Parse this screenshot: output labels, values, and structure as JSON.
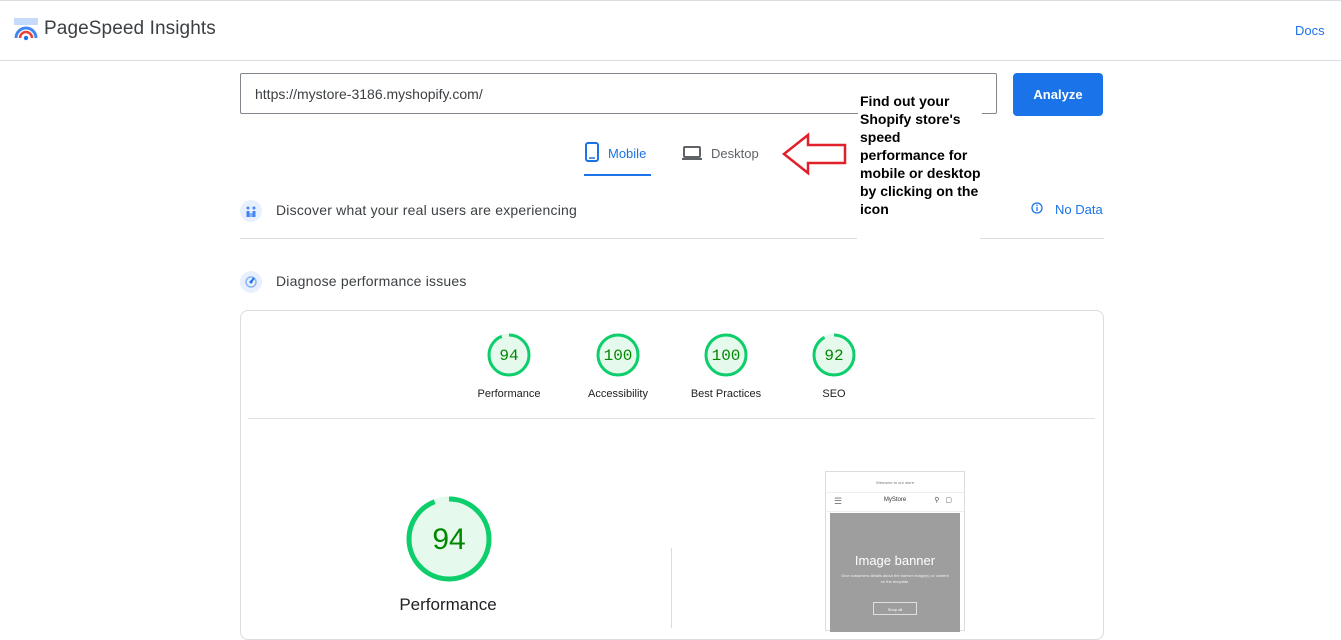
{
  "header": {
    "title": "PageSpeed Insights",
    "docs_label": "Docs"
  },
  "search": {
    "url_value": "https://mystore-3186.myshopify.com/",
    "analyze_label": "Analyze"
  },
  "tabs": [
    {
      "label": "Mobile",
      "icon": "phone-icon",
      "active": true
    },
    {
      "label": "Desktop",
      "icon": "laptop-icon",
      "active": false
    }
  ],
  "annotation": {
    "text": "Find out your Shopify store's speed performance for mobile or desktop by clicking on the icon",
    "arrow_color": "#e0202a"
  },
  "field_data": {
    "title": "Discover what your real users are experiencing",
    "no_data_label": "No Data"
  },
  "lab_data": {
    "title": "Diagnose performance issues"
  },
  "scores": [
    {
      "label": "Performance",
      "value": 94
    },
    {
      "label": "Accessibility",
      "value": 100
    },
    {
      "label": "Best Practices",
      "value": 100
    },
    {
      "label": "SEO",
      "value": 92
    }
  ],
  "main_score": {
    "label": "Performance",
    "value": 94
  },
  "preview": {
    "top_text": "Welcome to our store",
    "store_name": "MyStore",
    "banner_title": "Image banner",
    "banner_subtitle": "Give customers details about the banner image(s) or content on the template.",
    "button_label": "Shop all"
  },
  "colors": {
    "accent": "#1a73e8",
    "pass_green": "#0cce6b",
    "pass_text": "#008800",
    "pass_fill": "#e6f9ed"
  }
}
